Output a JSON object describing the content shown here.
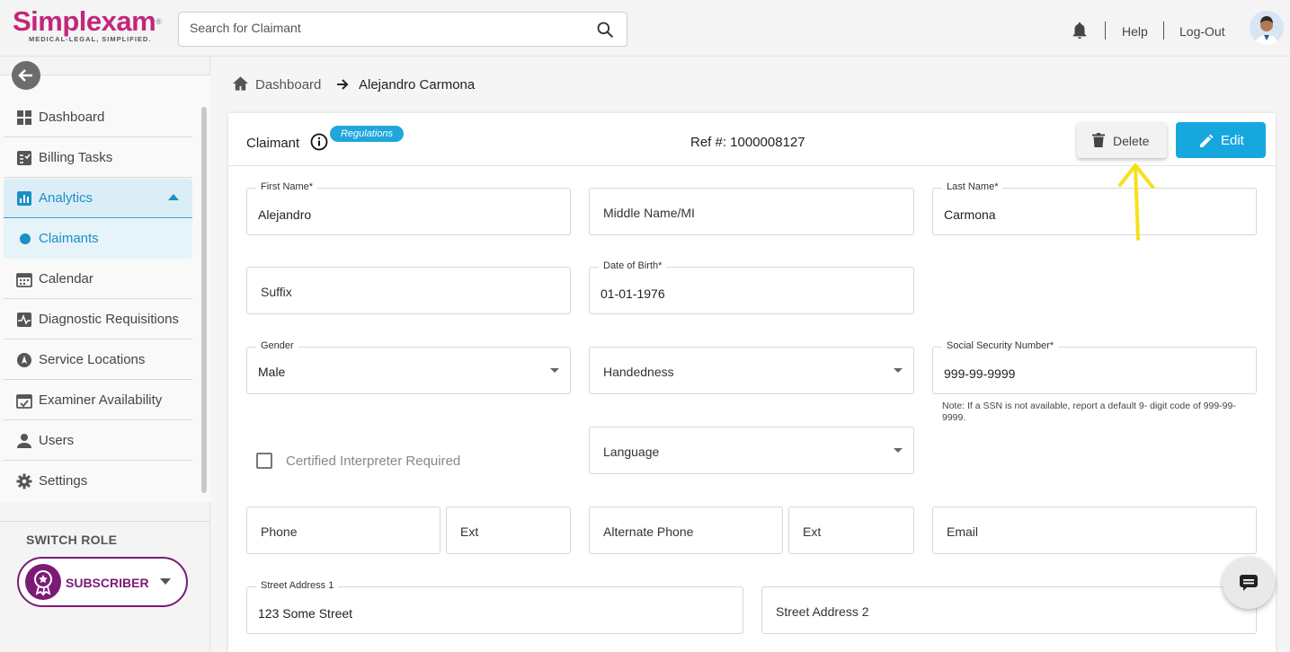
{
  "app": {
    "logo_text": "Simplexam",
    "logo_tagline": "MEDICAL-LEGAL, SIMPLIFIED."
  },
  "header": {
    "search_placeholder": "Search for Claimant",
    "help_label": "Help",
    "logout_label": "Log-Out"
  },
  "sidebar": {
    "items": [
      {
        "label": "Dashboard",
        "icon": "dashboard-icon"
      },
      {
        "label": "Billing Tasks",
        "icon": "billing-icon"
      },
      {
        "label": "Analytics",
        "icon": "analytics-icon"
      },
      {
        "label": "Claimants",
        "icon": "dot-icon"
      },
      {
        "label": "Calendar",
        "icon": "calendar-icon"
      },
      {
        "label": "Diagnostic Requisitions",
        "icon": "pulse-icon"
      },
      {
        "label": "Service Locations",
        "icon": "location-icon"
      },
      {
        "label": "Examiner Availability",
        "icon": "calendar-check-icon"
      },
      {
        "label": "Users",
        "icon": "user-icon"
      },
      {
        "label": "Settings",
        "icon": "gear-icon"
      }
    ],
    "switch_role_label": "SWITCH ROLE",
    "role": "SUBSCRIBER"
  },
  "breadcrumb": {
    "home": "Dashboard",
    "current": "Alejandro Carmona"
  },
  "card": {
    "title": "Claimant",
    "regulations_badge": "Regulations",
    "ref": "Ref #: 1000008127",
    "delete_label": "Delete",
    "edit_label": "Edit"
  },
  "form": {
    "first_name_label": "First Name*",
    "first_name": "Alejandro",
    "middle_placeholder": "Middle Name/MI",
    "last_name_label": "Last Name*",
    "last_name": "Carmona",
    "suffix_placeholder": "Suffix",
    "dob_label": "Date of Birth*",
    "dob": "01-01-1976",
    "gender_label": "Gender",
    "gender": "Male",
    "handedness_placeholder": "Handedness",
    "ssn_label": "Social Security Number*",
    "ssn": "999-99-9999",
    "ssn_note": "Note: If a SSN is not available, report a default 9- digit code of 999-99-9999.",
    "interpreter_label": "Certified Interpreter Required",
    "language_placeholder": "Language",
    "phone_placeholder": "Phone",
    "ext_placeholder": "Ext",
    "alt_phone_placeholder": "Alternate Phone",
    "alt_ext_placeholder": "Ext",
    "email_placeholder": "Email",
    "street1_label": "Street Address 1",
    "street1": "123 Some Street",
    "street2_placeholder": "Street Address 2"
  },
  "colors": {
    "brand": "#c2277a",
    "accent": "#17a7df",
    "role": "#7c1a76"
  }
}
